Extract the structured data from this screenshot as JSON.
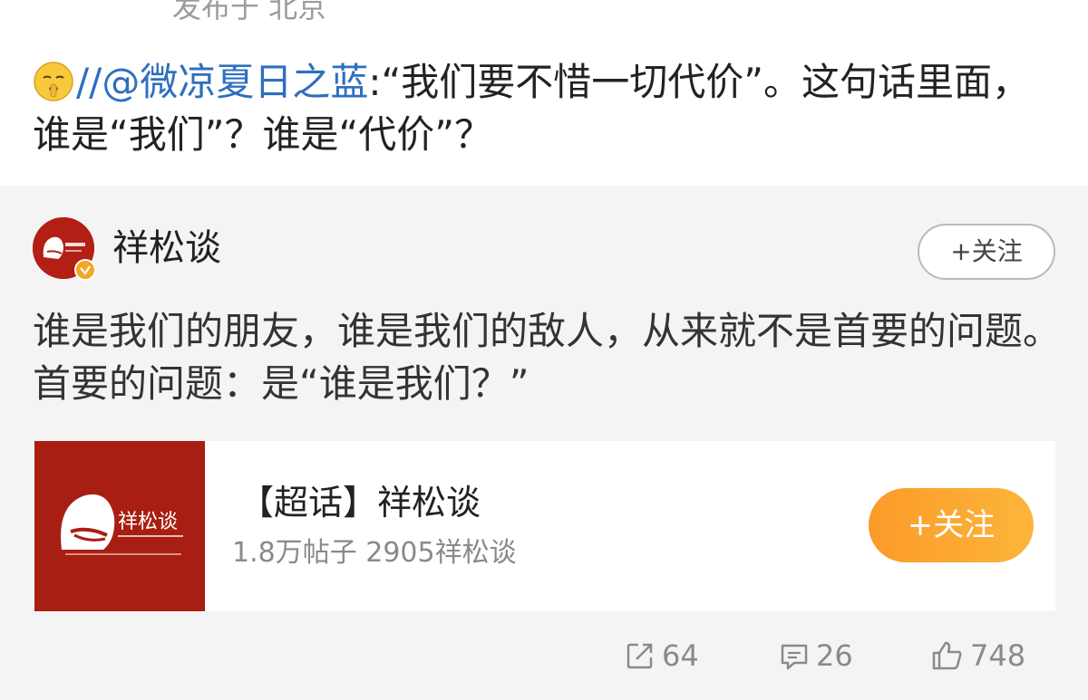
{
  "post": {
    "location_line": "发布于 北京",
    "repost_prefix": "//",
    "mention": "@微凉夏日之蓝",
    "repost_body": ":“我们要不惜一切代价”。这句话里面，谁是“我们”？谁是“代价”？"
  },
  "original": {
    "author_name": "祥松谈",
    "follow_label": "+关注",
    "text": "谁是我们的朋友，谁是我们的敌人，从来就不是首要的问题。首要的问题：是“谁是我们？”"
  },
  "topic_card": {
    "title": "【超话】祥松谈",
    "stats": "1.8万帖子 2905祥松谈",
    "follow_label": "+关注",
    "logo_text": "祥松谈"
  },
  "actions": {
    "repost_count": "64",
    "comment_count": "26",
    "like_count": "748"
  },
  "colors": {
    "mention": "#2e6fbf",
    "brand_red": "#a81e12",
    "follow_orange": "#fb9a2a",
    "verified": "#f5a623"
  },
  "icons": {
    "emoji": "shush-face-emoji",
    "verified": "verified-badge-icon",
    "repost": "repost-icon",
    "comment": "comment-icon",
    "like": "thumbs-up-icon"
  }
}
